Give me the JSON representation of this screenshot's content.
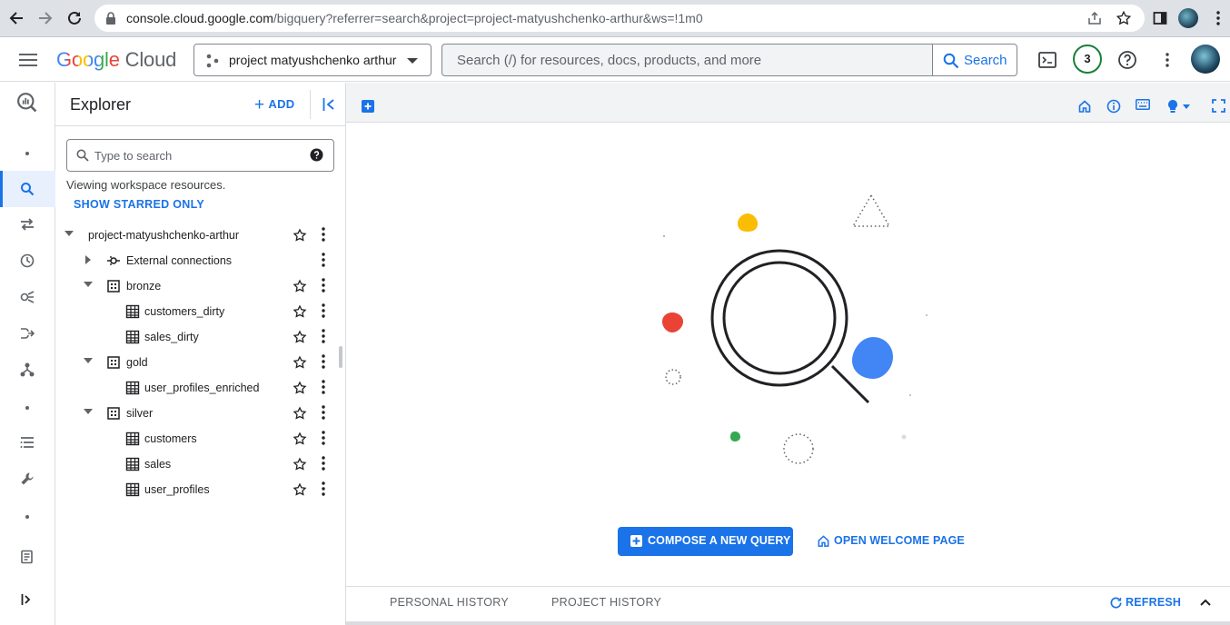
{
  "browser": {
    "url_host": "console.cloud.google.com",
    "url_path": "/bigquery?referrer=search&project=project-matyushchenko-arthur&ws=!1m0"
  },
  "header": {
    "logo_google": "Google",
    "logo_cloud": "Cloud",
    "project_name": "project matyushchenko arthur",
    "search_placeholder": "Search (/) for resources, docs, products, and more",
    "search_button": "Search",
    "notification_count": "3"
  },
  "explorer": {
    "title": "Explorer",
    "add_label": "ADD",
    "search_placeholder": "Type to search",
    "viewing_text": "Viewing workspace resources.",
    "starred_link": "SHOW STARRED ONLY",
    "tree": [
      {
        "label": "project-matyushchenko-arthur",
        "type": "project",
        "expanded": true
      },
      {
        "label": "External connections",
        "type": "connections",
        "expanded": false
      },
      {
        "label": "bronze",
        "type": "dataset",
        "expanded": true
      },
      {
        "label": "customers_dirty",
        "type": "table"
      },
      {
        "label": "sales_dirty",
        "type": "table"
      },
      {
        "label": "gold",
        "type": "dataset",
        "expanded": true
      },
      {
        "label": "user_profiles_enriched",
        "type": "table"
      },
      {
        "label": "silver",
        "type": "dataset",
        "expanded": true
      },
      {
        "label": "customers",
        "type": "table"
      },
      {
        "label": "sales",
        "type": "table"
      },
      {
        "label": "user_profiles",
        "type": "table"
      }
    ]
  },
  "main": {
    "compose_button": "COMPOSE A NEW QUERY",
    "welcome_button": "OPEN WELCOME PAGE"
  },
  "bottom_panel": {
    "tab_personal": "PERSONAL HISTORY",
    "tab_project": "PROJECT HISTORY",
    "refresh": "REFRESH"
  },
  "colors": {
    "accent": "#1a73e8",
    "illustration_yellow": "#fbbc04",
    "illustration_red": "#ea4335",
    "illustration_blue": "#4285f4",
    "illustration_green": "#34a853"
  }
}
